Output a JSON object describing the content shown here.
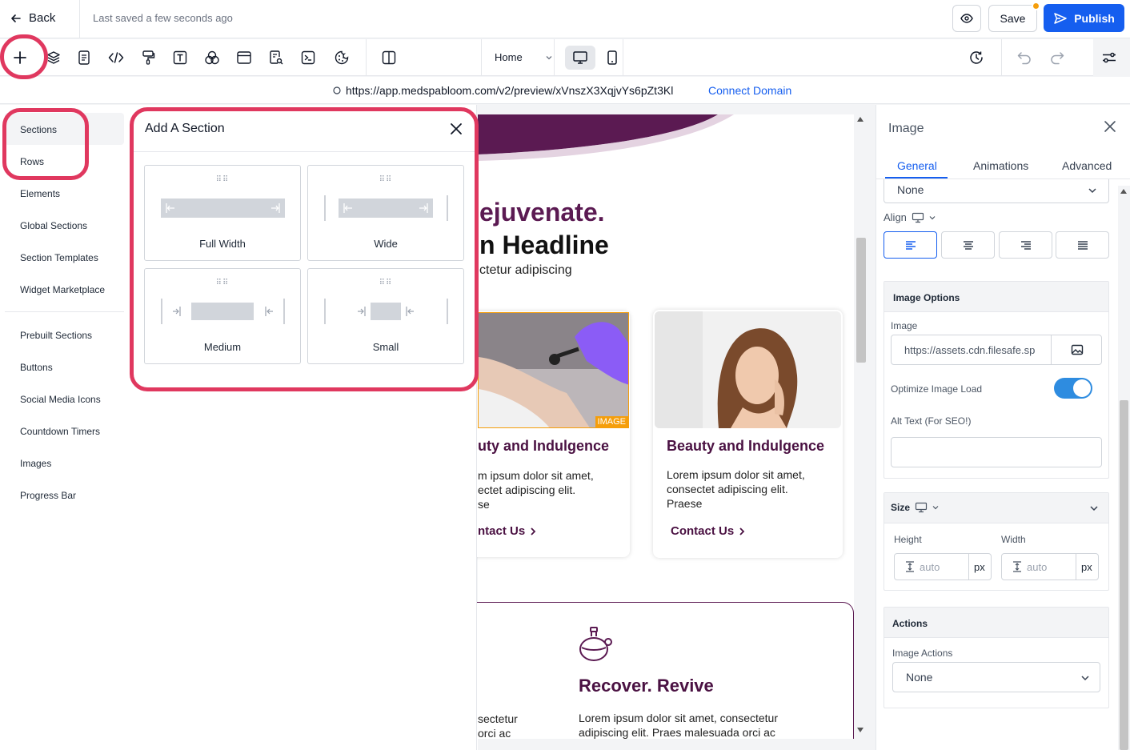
{
  "topbar": {
    "back_label": "Back",
    "last_saved": "Last saved a few seconds ago",
    "save_label": "Save",
    "publish_label": "Publish"
  },
  "toolbar": {
    "icons": [
      "add-icon",
      "layers-icon",
      "document-icon",
      "code-icon",
      "paint-roller-icon",
      "text-icon",
      "shapes-icon",
      "window-icon",
      "search-document-icon",
      "terminal-icon",
      "cookie-icon",
      "columns-icon"
    ],
    "page_select": "Home",
    "device_options": [
      "desktop-icon",
      "mobile-icon"
    ]
  },
  "urlbar": {
    "url": "https://app.medspabloom.com/v2/preview/xVnszX3XqjvYs6pZt3Kl",
    "connect_label": "Connect Domain"
  },
  "leftnav": {
    "items": [
      "Sections",
      "Rows",
      "Elements",
      "Global Sections",
      "Section Templates",
      "Widget Marketplace"
    ],
    "items2": [
      "Prebuilt Sections",
      "Buttons",
      "Social Media Icons",
      "Countdown Timers",
      "Images",
      "Progress Bar"
    ]
  },
  "panel": {
    "title": "Add A Section",
    "options": [
      "Full Width",
      "Wide",
      "Medium",
      "Small"
    ]
  },
  "canvas": {
    "headline1": "ejuvenate.",
    "headline2": "n Headline",
    "subtext": "ctetur adipiscing",
    "image_badge": "IMAGE",
    "card1_title": "uty and Indulgence",
    "card1_text": [
      "m ipsum dolor sit amet,",
      "ectet adipiscing elit.",
      "se"
    ],
    "card1_link": "ntact Us",
    "card2_title": "Beauty and Indulgence",
    "card2_text": [
      "Lorem ipsum dolor sit amet,",
      "consectet adipiscing elit.",
      "Praese"
    ],
    "card2_link": "Contact Us",
    "section2_title": "Recover. Revive",
    "section2_text": [
      "Lorem ipsum dolor sit amet, consectetur",
      "adipiscing elit. Praes malesuada orci ac"
    ],
    "section2_left": [
      "sectetur",
      "orci ac"
    ]
  },
  "rpanel": {
    "title": "Image",
    "tabs": [
      "General",
      "Animations",
      "Advanced"
    ],
    "top_select": "None",
    "align_label": "Align",
    "image_options_label": "Image Options",
    "image_label": "Image",
    "image_url": "https://assets.cdn.filesafe.sp",
    "optimize_label": "Optimize Image Load",
    "optimize_on": true,
    "alt_label": "Alt Text (For SEO!)",
    "alt_value": "",
    "size_label": "Size",
    "height_label": "Height",
    "width_label": "Width",
    "height_placeholder": "auto",
    "width_placeholder": "auto",
    "unit": "px",
    "actions_label": "Actions",
    "image_actions_label": "Image Actions",
    "image_actions_value": "None"
  },
  "colors": {
    "primary": "#155eef",
    "brand_purple": "#4a1142",
    "highlight": "#e0385f",
    "badge": "#f59e0b"
  }
}
